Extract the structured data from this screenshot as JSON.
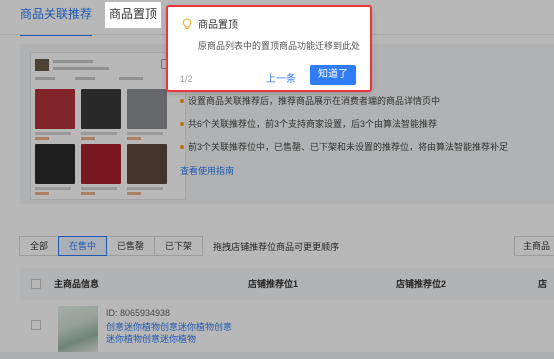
{
  "tabs": [
    {
      "label": "商品关联推荐",
      "active": true
    },
    {
      "label": "商品置顶",
      "active": false
    }
  ],
  "info": {
    "bullets": [
      "设置商品关联推荐后，推荐商品展示在消费者端的商品详情页中",
      "共6个关联推荐位，前3个支持商家设置，后3个由算法智能推荐",
      "前3个关联推荐位中，已售罄、已下架和未设置的推荐位，将由算法智能推荐补足"
    ],
    "guide_link": "查看使用指南"
  },
  "filters": {
    "buttons": [
      {
        "label": "全部",
        "active": false
      },
      {
        "label": "在售中",
        "active": true
      },
      {
        "label": "已售罄",
        "active": false
      },
      {
        "label": "已下架",
        "active": false
      }
    ],
    "hint": "拖拽店铺推荐位商品可更更顺序",
    "sort_value": "主商品"
  },
  "table": {
    "headers": [
      "主商品信息",
      "店铺推荐位1",
      "店铺推荐位2",
      "店铺"
    ],
    "rows": [
      {
        "id": "ID: 8065934938",
        "name": "创意迷你植物创意迷你植物创意迷你植物创意迷你植物"
      }
    ]
  },
  "popover": {
    "title": "商品置顶",
    "body": "原商品列表中的置顶商品功能迁移到此处",
    "page": "1/2",
    "prev_label": "上一条",
    "ok_label": "知道了"
  },
  "colors": {
    "accent": "#2f7cf6",
    "popover_border": "#e8383d",
    "bullet": "#f5a623"
  },
  "mock_images": [
    "#b3323b",
    "#3a3a3a",
    "#8c8f95",
    "#2b2b2b",
    "#a8222e",
    "#5e4a3c"
  ]
}
